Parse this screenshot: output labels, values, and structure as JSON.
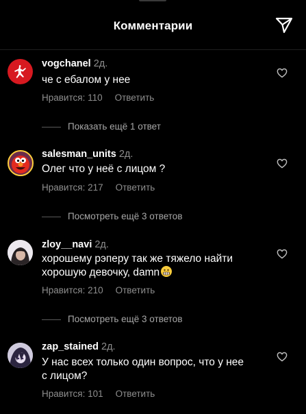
{
  "header": {
    "title": "Комментарии"
  },
  "comments": [
    {
      "user": "vogchanel",
      "time": "2д.",
      "text": "че с ебалом у нее",
      "likes": "Нравится: 110",
      "reply": "Ответить",
      "more": "Показать ещё 1 ответ"
    },
    {
      "user": "salesman_units",
      "time": "2д.",
      "text": "Олег что у неё с лицом ?",
      "likes": "Нравится: 217",
      "reply": "Ответить",
      "more": "Посмотреть ещё 3 ответов"
    },
    {
      "user": "zloy__navi",
      "time": "2д.",
      "text_line1": "хорошему рэперу так же тяжело найти",
      "text_line2": "хорошую девочку, damn",
      "likes": "Нравится: 210",
      "reply": "Ответить",
      "more": "Посмотреть ещё 3 ответов"
    },
    {
      "user": "zap_stained",
      "time": "2д.",
      "text_line1": "У нас всех только один вопрос, что у нее",
      "text_line2": "с лицом?",
      "likes": "Нравится: 101",
      "reply": "Ответить"
    }
  ],
  "colors": {
    "background": "#000000",
    "secondary_text": "#8e8e8e",
    "avatar1": "#d71920"
  },
  "icons": {
    "send": "paper-plane-icon",
    "like": "heart-outline-icon"
  }
}
